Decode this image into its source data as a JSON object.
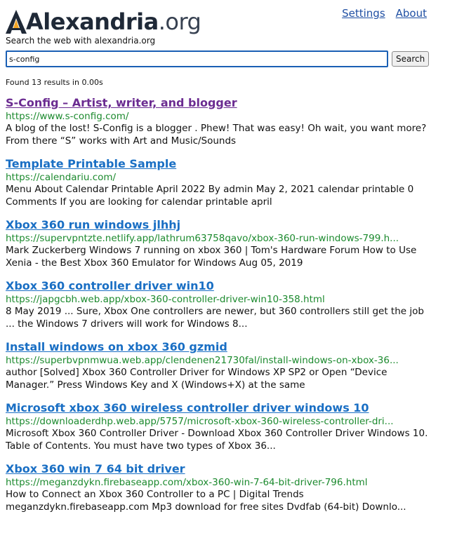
{
  "header": {
    "logo": {
      "bold": "Alexandria",
      "light": ".org"
    },
    "links": {
      "settings": "Settings",
      "about": "About"
    }
  },
  "tagline": "Search the web with alexandria.org",
  "search": {
    "query": "s-config",
    "button_label": "Search"
  },
  "result_count": "Found 13 results in 0.00s",
  "results": [
    {
      "title": "S-Config – Artist, writer, and blogger",
      "url": "https://www.s-config.com/",
      "snippet": "A blog of the lost! S-Config is a blogger . Phew! That was easy! Oh wait, you want more? From there “S” works with Art and Music/Sounds",
      "visited": true
    },
    {
      "title": "Template Printable Sample",
      "url": "https://calendariu.com/",
      "snippet": "Menu About Calendar Printable April 2022 By admin May 2, 2021 calendar printable 0 Comments If you are looking for calendar printable april",
      "visited": false
    },
    {
      "title": "Xbox 360 run windows jlhhj",
      "url": "https://supervpntzte.netlify.app/lathrum63758qavo/xbox-360-run-windows-799.h...",
      "snippet": "Mark Zuckerberg Windows 7 running on xbox 360 | Tom's Hardware Forum How to Use Xenia - the Best Xbox 360 Emulator for Windows Aug 05, 2019",
      "visited": false
    },
    {
      "title": "Xbox 360 controller driver win10",
      "url": "https://japgcbh.web.app/xbox-360-controller-driver-win10-358.html",
      "snippet": "8 May 2019 ... Sure, Xbox One controllers are newer, but 360 controllers still get the job ... the Windows 7 drivers will work for Windows 8...",
      "visited": false
    },
    {
      "title": "Install windows on xbox 360 gzmid",
      "url": "https://superbvpnmwua.web.app/clendenen21730fal/install-windows-on-xbox-36...",
      "snippet": "author [Solved] Xbox 360 Controller Driver for Windows XP SP2 or Open “Device Manager.” Press Windows Key and X (Windows+X) at the same",
      "visited": false
    },
    {
      "title": "Microsoft xbox 360 wireless controller driver windows 10",
      "url": "https://downloaderdhp.web.app/5757/microsoft-xbox-360-wireless-controller-dri...",
      "snippet": "Microsoft Xbox 360 Controller Driver - Download Xbox 360 Controller Driver Windows 10. Table of Contents. You must have two types of Xbox 36...",
      "visited": false
    },
    {
      "title": "Xbox 360 win 7 64 bit driver",
      "url": "https://meganzdykn.firebaseapp.com/xbox-360-win-7-64-bit-driver-796.html",
      "snippet": "How to Connect an Xbox 360 Controller to a PC | Digital Trends meganzdykn.firebaseapp.com Mp3 download for free sites Dvdfab (64-bit) Downlo...",
      "visited": false
    }
  ],
  "colors": {
    "link": "#1a6fc4",
    "visited_link": "#6b2c91",
    "url": "#1c8a2e",
    "logo_accent": "#f5a623"
  }
}
